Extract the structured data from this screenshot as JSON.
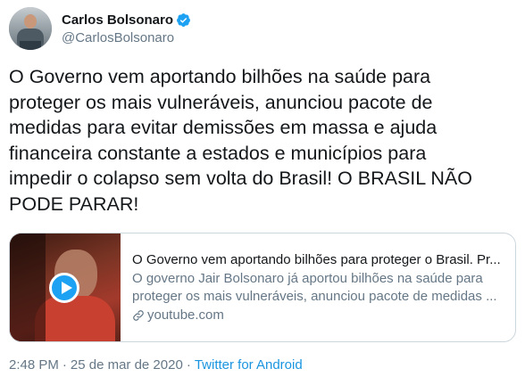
{
  "user": {
    "display_name": "Carlos Bolsonaro",
    "handle": "@CarlosBolsonaro",
    "verified": true
  },
  "tweet": {
    "text": "O Governo vem aportando bilhões na saúde para\nproteger os mais vulneráveis, anunciou pacote de\nmedidas para evitar demissões em massa e ajuda\nfinanceira constante a estados e municípios para\nimpedir o colapso sem volta do Brasil! O BRASIL NÃO\nPODE PARAR!"
  },
  "card": {
    "title": "O Governo vem aportando bilhões para proteger o Brasil. Pr...",
    "description": "O governo Jair Bolsonaro já aportou bilhões na saúde para proteger os mais vulneráveis, anunciou pacote de medidas ...",
    "domain": "youtube.com",
    "media_icon": "play-icon"
  },
  "meta": {
    "time": "2:48 PM",
    "separator": "·",
    "date": "25 de mar de 2020",
    "source": "Twitter for Android"
  },
  "colors": {
    "text": "#14171a",
    "secondary": "#657786",
    "accent": "#1da1f2",
    "link": "#1b95e0",
    "border": "#ccd6dd"
  }
}
